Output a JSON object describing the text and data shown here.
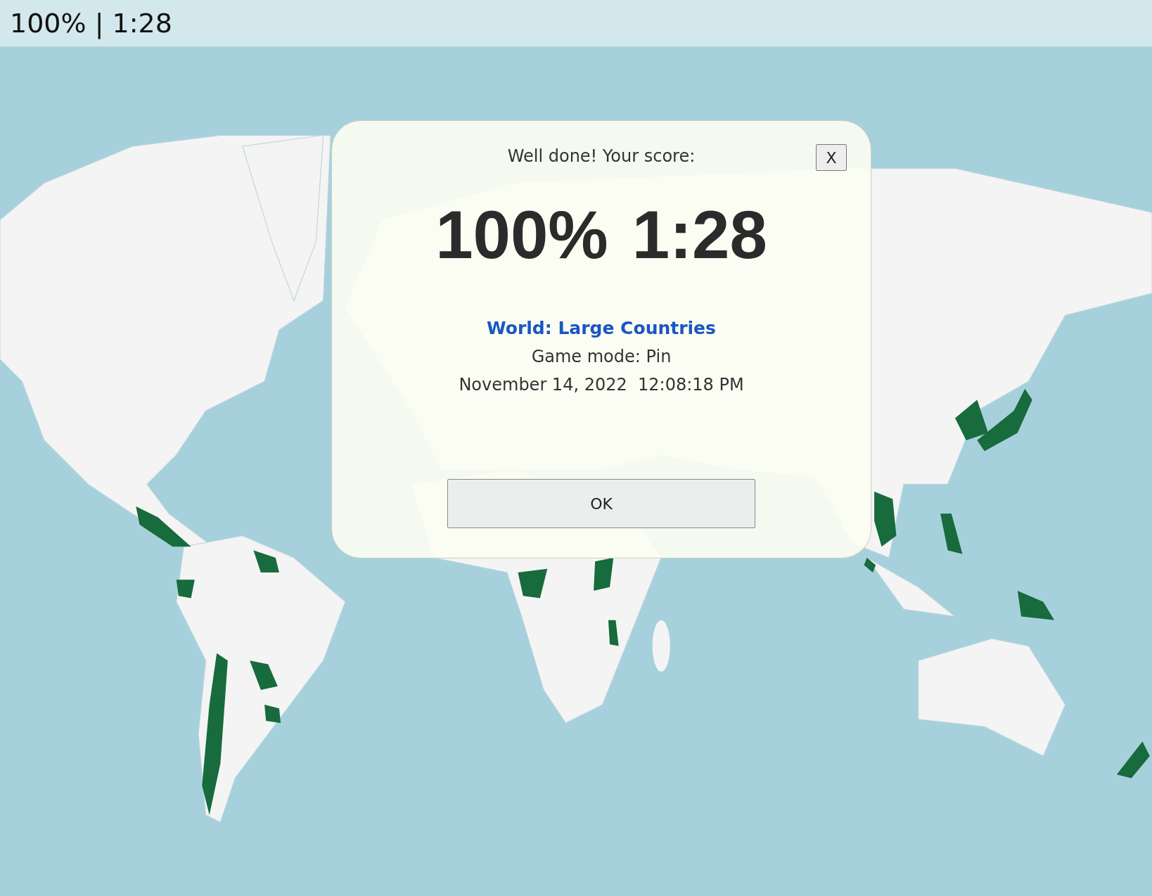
{
  "status_bar": {
    "text": "100% | 1:28"
  },
  "dialog": {
    "heading": "Well done! Your score:",
    "close_button": "X",
    "score": "100%",
    "time": "1:28",
    "quiz_link": "World: Large Countries",
    "game_mode": "Game mode: Pin",
    "date": "November 14, 2022  12:08:18 PM",
    "ok_button": "OK"
  }
}
